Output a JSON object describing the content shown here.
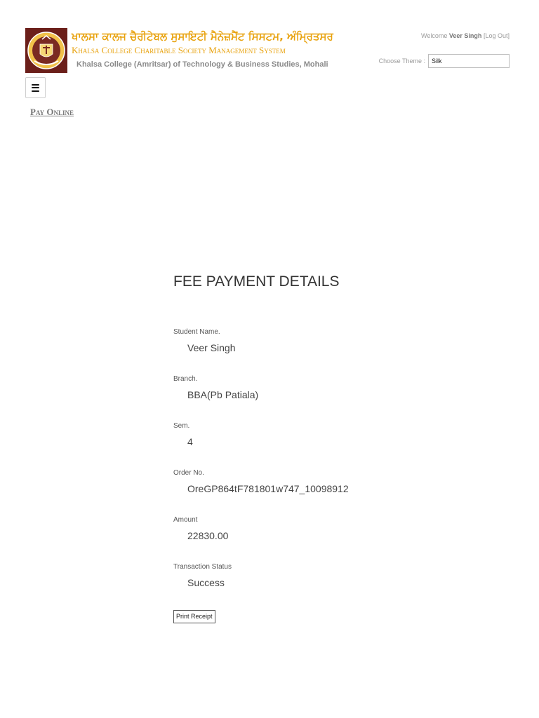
{
  "header": {
    "title_punjabi": "ਖਾਲਸਾ ਕਾਲਜ ਚੈਰੀਟੇਬਲ ਸੁਸਾਇਟੀ ਮੈਨੇਜ਼ਮੈਂਟ ਸਿਸਟਮ, ਅੰਮ੍ਰਿਤਸਰ",
    "title_english": "Khalsa College Charitable Society Management System",
    "college_name": "Khalsa College (Amritsar) of Technology & Business Studies, Mohali",
    "logo_icon": "college-crest-icon"
  },
  "user": {
    "welcome_label": "Welcome",
    "name": "Veer Singh",
    "logout_open": "[",
    "logout_label": "Log Out",
    "logout_close": "]"
  },
  "theme": {
    "label": "Choose Theme :",
    "selected": "Silk"
  },
  "nav": {
    "menu_icon": "hamburger-menu-icon",
    "pay_online": "Pay Online"
  },
  "fee_details": {
    "heading": "FEE PAYMENT DETAILS",
    "fields": [
      {
        "label": "Student Name.",
        "value": "Veer Singh"
      },
      {
        "label": "Branch.",
        "value": "BBA(Pb Patiala)"
      },
      {
        "label": "Sem.",
        "value": "4"
      },
      {
        "label": "Order No.",
        "value": "OreGP864tF781801w747_10098912"
      },
      {
        "label": "Amount",
        "value": "22830.00"
      },
      {
        "label": "Transaction Status",
        "value": "Success"
      }
    ],
    "print_button": "Print Receipt"
  },
  "colors": {
    "brand_gold": "#e8a20d",
    "crest_maroon": "#6b1f1a",
    "muted_text": "#9a9a9a"
  }
}
